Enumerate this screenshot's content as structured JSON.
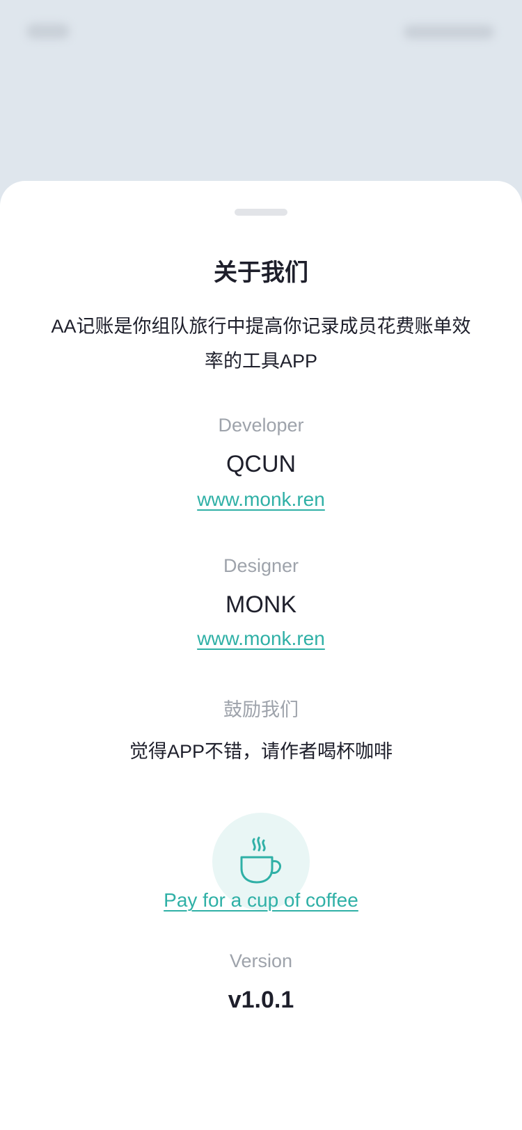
{
  "sheet": {
    "title": "关于我们",
    "description": "AA记账是你组队旅行中提高你记录成员花费账单效率的工具APP"
  },
  "developer": {
    "label": "Developer",
    "name": "QCUN",
    "link": "www.monk.ren"
  },
  "designer": {
    "label": "Designer",
    "name": "MONK",
    "link": "www.monk.ren"
  },
  "support": {
    "label": "鼓励我们",
    "text": "觉得APP不错，请作者喝杯咖啡",
    "icon": "coffee-cup-icon",
    "link": "Pay for a cup of coffee"
  },
  "version": {
    "label": "Version",
    "value": "v1.0.1"
  },
  "colors": {
    "accent": "#2fb0a6",
    "accent_bg": "#e9f6f5",
    "muted": "#9ea3ab",
    "text": "#1e1f2b",
    "backdrop": "#dfe6ed"
  }
}
